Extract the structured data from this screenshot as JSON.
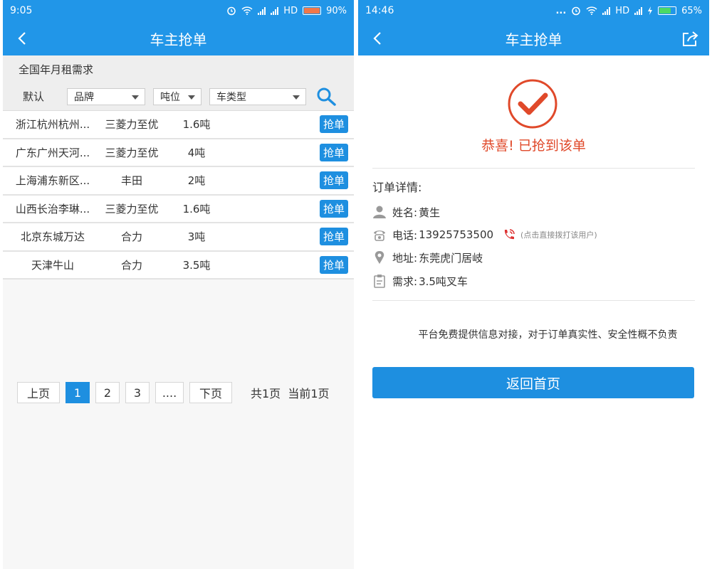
{
  "left": {
    "status": {
      "time": "9:05",
      "network": "HD",
      "battery": "90%",
      "battery_level": 0.9,
      "battery_color": "#f0784a"
    },
    "title": "车主抢单",
    "section": "全国年月租需求",
    "filters": {
      "default_label": "默认",
      "brand": "品牌",
      "tonnage": "吨位",
      "vehicle_type": "车类型"
    },
    "rows": [
      {
        "location": "浙江杭州杭州...",
        "brand": "三菱力至优",
        "tonnage": "1.6吨",
        "action": "抢单"
      },
      {
        "location": "广东广州天河...",
        "brand": "三菱力至优",
        "tonnage": "4吨",
        "action": "抢单"
      },
      {
        "location": "上海浦东新区...",
        "brand": "丰田",
        "tonnage": "2吨",
        "action": "抢单"
      },
      {
        "location": "山西长治李琳...",
        "brand": "三菱力至优",
        "tonnage": "1.6吨",
        "action": "抢单"
      },
      {
        "location": "北京东城万达",
        "brand": "合力",
        "tonnage": "3吨",
        "action": "抢单"
      },
      {
        "location": "天津牛山",
        "brand": "合力",
        "tonnage": "3.5吨",
        "action": "抢单"
      }
    ],
    "pagination": {
      "prev": "上页",
      "pages": [
        "1",
        "2",
        "3"
      ],
      "current": "1",
      "ellipsis": "....",
      "next": "下页",
      "total_text": "共1页",
      "current_text": "当前1页"
    }
  },
  "right": {
    "status": {
      "time": "14:46",
      "dots": "...",
      "network": "HD",
      "battery": "65%",
      "battery_level": 0.65,
      "battery_color": "#4cd964"
    },
    "title": "车主抢单",
    "success_message": "恭喜! 已抢到该单",
    "detail_title": "订单详情:",
    "name_label": "姓名:",
    "name_value": "黄生",
    "phone_label": "电话:",
    "phone_value": "13925753500",
    "call_hint": "(点击直接拨打该用户)",
    "address_label": "地址:",
    "address_value": "东莞虎门居岐",
    "demand_label": "需求:",
    "demand_value": "3.5吨叉车",
    "disclaimer": "平台免费提供信息对接，对于订单真实性、安全性概不负责",
    "home_button": "返回首页"
  },
  "colors": {
    "primary": "#2196e8",
    "button": "#1e8fe0",
    "success": "#e0492a"
  },
  "icons": [
    "back-icon",
    "share-icon",
    "search-icon",
    "check-circle-icon",
    "person-icon",
    "phone-icon",
    "call-icon",
    "location-icon",
    "clipboard-icon",
    "alarm-icon",
    "wifi-icon",
    "signal-icon",
    "battery-icon"
  ]
}
